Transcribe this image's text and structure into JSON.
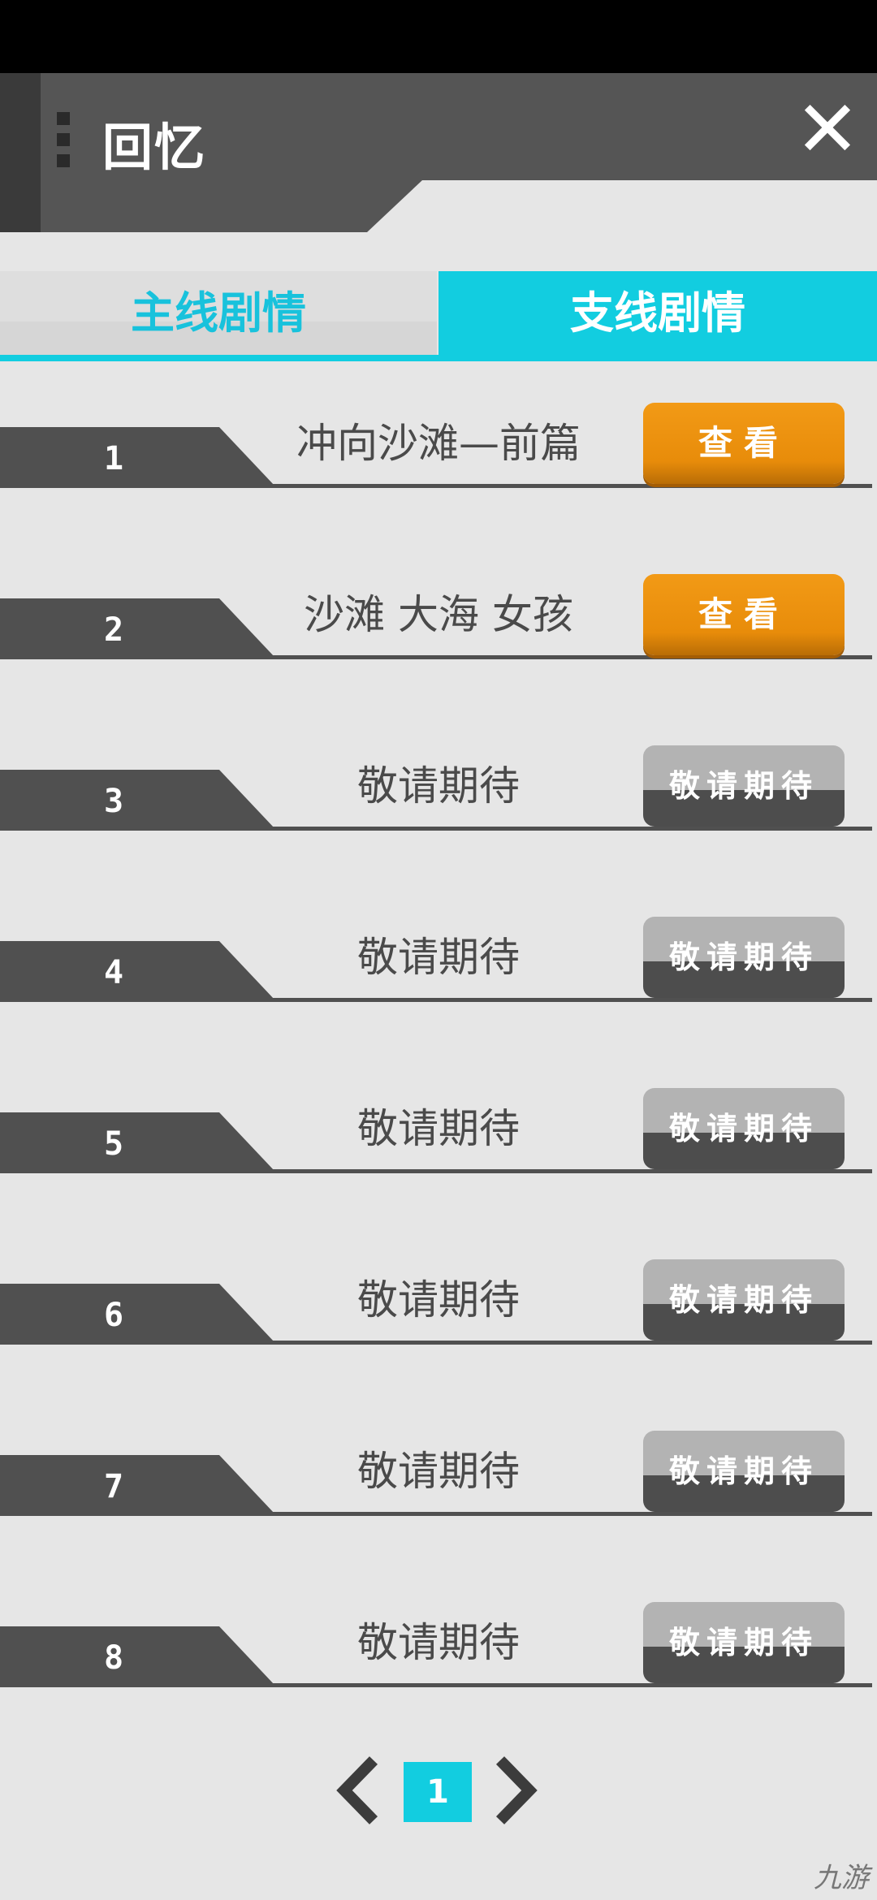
{
  "header": {
    "title": "回忆"
  },
  "tabs": {
    "main": "主线剧情",
    "side": "支线剧情"
  },
  "rows": [
    {
      "num": "1",
      "title": "冲向沙滩—前篇",
      "button": "查看",
      "state": "view"
    },
    {
      "num": "2",
      "title": "沙滩 大海 女孩",
      "button": "查看",
      "state": "view"
    },
    {
      "num": "3",
      "title": "敬请期待",
      "button": "敬请期待",
      "state": "locked"
    },
    {
      "num": "4",
      "title": "敬请期待",
      "button": "敬请期待",
      "state": "locked"
    },
    {
      "num": "5",
      "title": "敬请期待",
      "button": "敬请期待",
      "state": "locked"
    },
    {
      "num": "6",
      "title": "敬请期待",
      "button": "敬请期待",
      "state": "locked"
    },
    {
      "num": "7",
      "title": "敬请期待",
      "button": "敬请期待",
      "state": "locked"
    },
    {
      "num": "8",
      "title": "敬请期待",
      "button": "敬请期待",
      "state": "locked"
    }
  ],
  "pagination": {
    "current": "1"
  },
  "watermark": "九游",
  "colors": {
    "accent": "#12cde0",
    "view_button": "#e88c0a",
    "dark": "#505050"
  },
  "icons": {
    "close": "close-icon",
    "prev": "chevron-left-icon",
    "next": "chevron-right-icon"
  }
}
